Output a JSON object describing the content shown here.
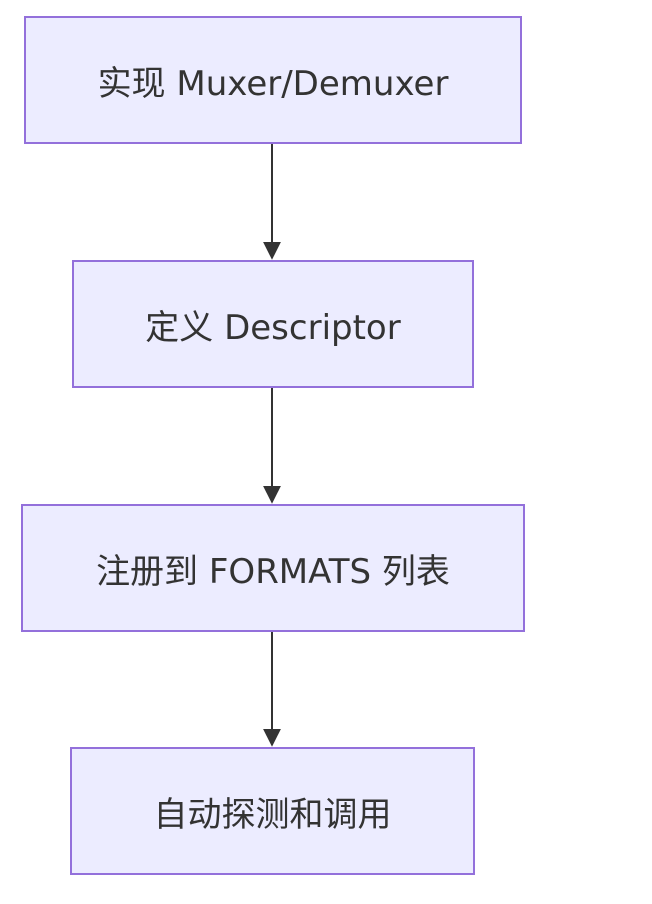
{
  "diagram": {
    "type": "flowchart",
    "direction": "top-down",
    "colors": {
      "node_fill": "#ECECFF",
      "node_border": "#9370DB",
      "text": "#333333",
      "edge": "#333333"
    },
    "nodes": [
      {
        "id": "n1",
        "label": "实现 Muxer/Demuxer"
      },
      {
        "id": "n2",
        "label": "定义 Descriptor"
      },
      {
        "id": "n3",
        "label": "注册到 FORMATS 列表"
      },
      {
        "id": "n4",
        "label": "自动探测和调用"
      }
    ],
    "edges": [
      {
        "from": "n1",
        "to": "n2"
      },
      {
        "from": "n2",
        "to": "n3"
      },
      {
        "from": "n3",
        "to": "n4"
      }
    ]
  }
}
